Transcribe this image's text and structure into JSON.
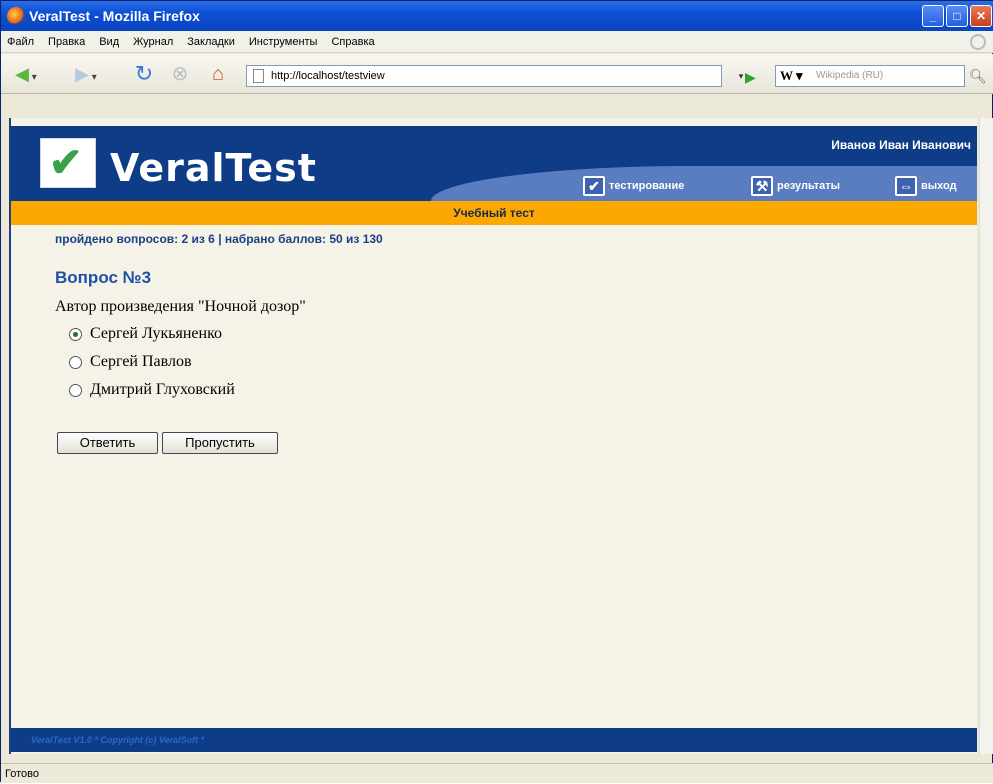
{
  "browser": {
    "title": "VeralTest - Mozilla Firefox",
    "menu": [
      "Файл",
      "Правка",
      "Вид",
      "Журнал",
      "Закладки",
      "Инструменты",
      "Справка"
    ],
    "url": "http://localhost/testview",
    "search_placeholder": "Wikipedia (RU)",
    "search_engine_logo": "W",
    "status": "Готово"
  },
  "site": {
    "logo_text": "VeralTest",
    "user_name": "Иванов Иван Иванович",
    "nav": {
      "testing": "тестирование",
      "results": "результаты",
      "exit": "выход"
    },
    "test_title": "Учебный тест",
    "progress_text": "пройдено вопросов: 2 из 6 | набрано баллов: 50 из 130",
    "question_title": "Вопрос №3",
    "question_text": "Автор произведения \"Ночной дозор\"",
    "options": [
      {
        "label": "Сергей Лукьяненко",
        "selected": true
      },
      {
        "label": "Сергей Павлов",
        "selected": false
      },
      {
        "label": "Дмитрий Глуховский",
        "selected": false
      }
    ],
    "buttons": {
      "answer": "Ответить",
      "skip": "Пропустить"
    },
    "footer": "VeralTest V1.0 * Copyright (c) VeralSoft *"
  },
  "colors": {
    "header_bg": "#0e3c86",
    "title_bar_bg": "#fba900",
    "page_bg": "#f5f3e7",
    "accent_link": "#1c51a6"
  }
}
